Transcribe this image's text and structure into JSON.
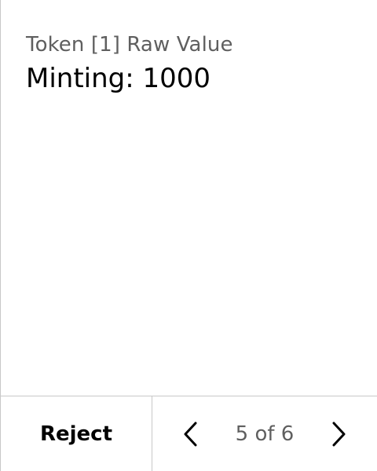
{
  "field": {
    "label": "Token [1] Raw Value",
    "value": "Minting: 1000"
  },
  "footer": {
    "reject_label": "Reject",
    "page_indicator": "5 of 6",
    "prev_icon": "chevron-left-icon",
    "next_icon": "chevron-right-icon"
  },
  "colors": {
    "divider": "#c8c8c8",
    "muted_text": "#5f5f5f",
    "primary_text": "#000000",
    "background": "#ffffff"
  }
}
